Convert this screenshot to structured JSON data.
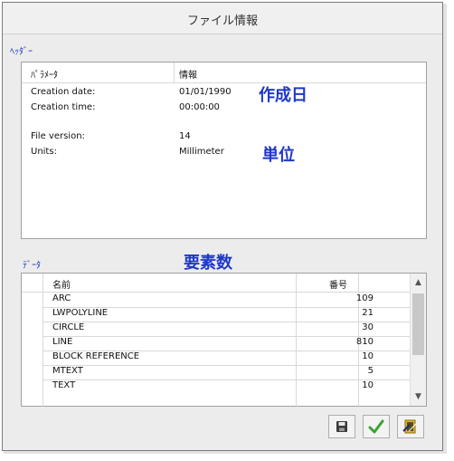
{
  "window": {
    "title": "ファイル情報"
  },
  "header_group": {
    "label": "ﾍｯﾀﾞｰ",
    "columns": [
      "ﾊﾟﾗﾒｰﾀ",
      "情報"
    ],
    "rows": [
      {
        "param": "Creation date:",
        "value": "01/01/1990"
      },
      {
        "param": "Creation time:",
        "value": "00:00:00"
      },
      {
        "param": "File version:",
        "value": "14"
      },
      {
        "param": "Units:",
        "value": "Millimeter"
      }
    ]
  },
  "data_group": {
    "label": "ﾃﾞｰﾀ",
    "columns": [
      "名前",
      "番号"
    ],
    "rows": [
      {
        "name": "ARC",
        "count": "109"
      },
      {
        "name": "LWPOLYLINE",
        "count": "21"
      },
      {
        "name": "CIRCLE",
        "count": "30"
      },
      {
        "name": "LINE",
        "count": "810"
      },
      {
        "name": "BLOCK REFERENCE",
        "count": "10"
      },
      {
        "name": "MTEXT",
        "count": "5"
      },
      {
        "name": "TEXT",
        "count": "10"
      }
    ]
  },
  "annotations": {
    "creation_date": "作成日",
    "units": "単位",
    "element_count": "要素数"
  },
  "buttons": [
    {
      "name": "save-button",
      "icon": "floppy-disk-icon"
    },
    {
      "name": "ok-button",
      "icon": "checkmark-icon"
    },
    {
      "name": "cancel-button",
      "icon": "exit-icon"
    }
  ],
  "colors": {
    "annotation": "#1f37c9",
    "group_label": "#1a3cbf",
    "check": "#3aa52f"
  }
}
